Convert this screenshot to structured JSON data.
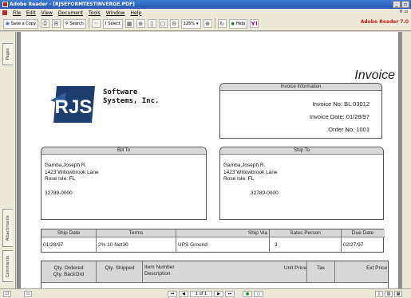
{
  "window": {
    "title": "Adobe Reader - [RJSEFORMTESTINVERGE.PDF]",
    "min": "_",
    "restore": "▫"
  },
  "menu": [
    "File",
    "Edit",
    "View",
    "Document",
    "Tools",
    "Window",
    "Help"
  ],
  "toolbar": {
    "save_copy": "Save a Copy",
    "search": "Search",
    "select": "Select",
    "zoom": "125%",
    "help": "Help",
    "brand": "Adobe Reader 7.0"
  },
  "left_tabs": {
    "pages": "Pages",
    "attachments": "Attachments",
    "comments": "Comments"
  },
  "status": {
    "page": "1 of 1"
  },
  "invoice": {
    "title": "Invoice",
    "company_line1": "Software",
    "company_line2": "Systems, Inc.",
    "logo_text": "RJS",
    "info_header": "Invoice Information",
    "invoice_no_label": "Invoice No:",
    "invoice_no": "BL 03012",
    "invoice_date_label": "Invoice Date:",
    "invoice_date": "01/28/97",
    "order_no_label": "Order No:",
    "order_no": "1001",
    "bill_to_header": "Bill To",
    "ship_to_header": "Ship To",
    "bill_name": "Gamba,Joseph R.",
    "bill_street": "1423 Willowbrook Lane",
    "bill_city": "Rose Isle, FL",
    "bill_zip": "32789-0000",
    "ship_name": "Gamba,Joseph R.",
    "ship_street": "1423 Willowbrook Lane",
    "ship_city": "Rose Isle, FL",
    "ship_zip": "32789-0000",
    "ship_headers": [
      "Ship Date",
      "Terms",
      "Ship Via",
      "Sales Person",
      "Due Date"
    ],
    "ship_values": [
      "01/28/97",
      "2% 10 Net30",
      "UPS Ground",
      "3",
      "02/27/97"
    ],
    "item_headers": {
      "qty_ordered": "Qty. Ordered",
      "qty_backord": "Qty. BackOrd",
      "qty_shipped": "Qty. Shipped",
      "item_number": "Item Number",
      "description": "Description",
      "unit_price": "Unit Price",
      "tax": "Tax",
      "ext_price": "Ext Price"
    }
  },
  "colors": {
    "titlebar": "#2458b5",
    "brand": "#cc2020",
    "logo": "#1d3d6e"
  }
}
